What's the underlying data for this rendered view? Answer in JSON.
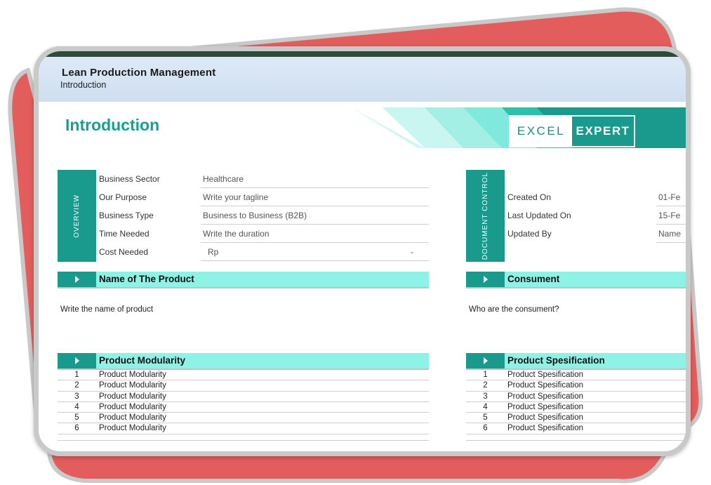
{
  "header": {
    "title": "Lean Production Management",
    "subtitle": "Introduction"
  },
  "page_title": "Introduction",
  "logo": {
    "left": "EXCEL",
    "right": "EXPERT"
  },
  "overview": {
    "tab_label": "OVERVIEW",
    "rows": [
      {
        "label": "Business Sector",
        "value": "Healthcare"
      },
      {
        "label": "Our Purpose",
        "value": "Write your tagline"
      },
      {
        "label": "Business Type",
        "value": "Business to Business (B2B)"
      },
      {
        "label": "Time Needed",
        "value": "Write the duration"
      },
      {
        "label": "Cost Needed",
        "value": "Rp",
        "value_suffix": "-"
      }
    ]
  },
  "document_control": {
    "tab_label": "DOCUMENT CONTROL",
    "rows": [
      {
        "label": "Created On",
        "value": "01-Fe"
      },
      {
        "label": "Last Updated On",
        "value": "15-Fe"
      },
      {
        "label": "Updated By",
        "value": "Name"
      }
    ]
  },
  "sections": {
    "product_name": {
      "title": "Name of The Product",
      "text": "Write the name of product"
    },
    "consument": {
      "title": "Consument",
      "text": "Who are the consument?"
    },
    "modularity": {
      "title": "Product Modularity",
      "items": [
        {
          "num": "1",
          "text": "Product Modularity"
        },
        {
          "num": "2",
          "text": "Product Modularity"
        },
        {
          "num": "3",
          "text": "Product Modularity"
        },
        {
          "num": "4",
          "text": "Product Modularity"
        },
        {
          "num": "5",
          "text": "Product Modularity"
        },
        {
          "num": "6",
          "text": "Product Modularity"
        }
      ]
    },
    "spesification": {
      "title": "Product Spesification",
      "items": [
        {
          "num": "1",
          "text": "Product Spesification"
        },
        {
          "num": "2",
          "text": "Product Spesification"
        },
        {
          "num": "3",
          "text": "Product Spesification"
        },
        {
          "num": "4",
          "text": "Product Spesification"
        },
        {
          "num": "5",
          "text": "Product Spesification"
        },
        {
          "num": "6",
          "text": "Product Spesification"
        }
      ]
    }
  },
  "colors": {
    "accent": "#1a9a8c",
    "section_fill": "#8ff2e6",
    "title_teal": "#16a08f",
    "deco_red": "#e35d5d"
  }
}
